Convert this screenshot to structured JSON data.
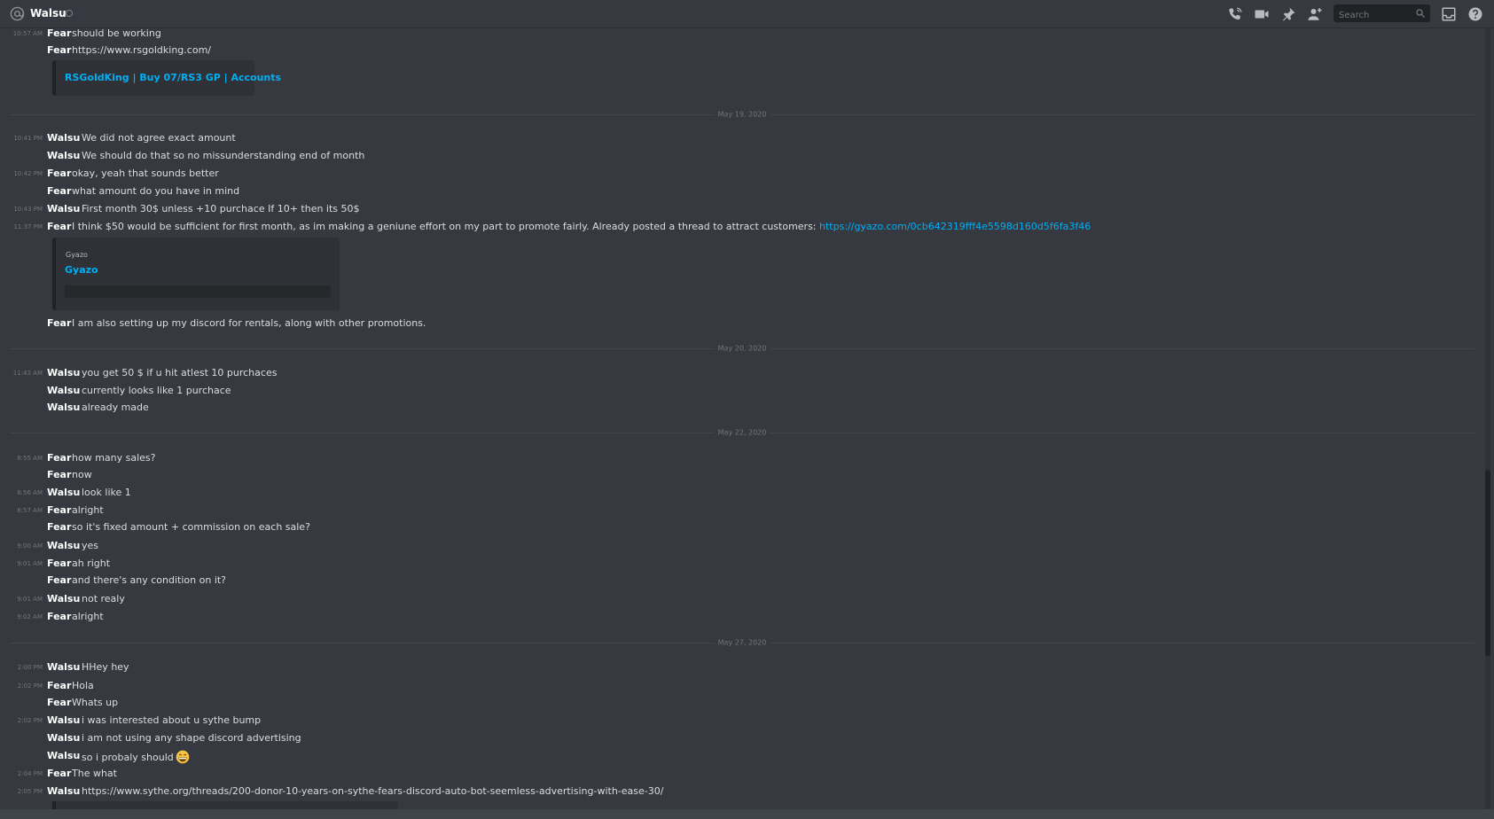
{
  "header": {
    "channel_name": "Walsu",
    "search_placeholder": "Search"
  },
  "messages": [
    {
      "ts": "10:57 AM",
      "author": "Fear",
      "text": "should be working"
    },
    {
      "ts": "",
      "author": "Fear",
      "text": "",
      "link": "https://www.rsgoldking.com/"
    },
    {
      "ts": "10:41 PM",
      "author": "Walsu",
      "text": "We did not agree exact amount"
    },
    {
      "ts": "",
      "author": "Walsu",
      "text": "We should do that so no missunderstanding end of month"
    },
    {
      "ts": "10:42 PM",
      "author": "Fear",
      "text": "okay, yeah that sounds better"
    },
    {
      "ts": "",
      "author": "Fear",
      "text": "what amount do you have in mind"
    },
    {
      "ts": "10:43 PM",
      "author": "Walsu",
      "text": "First month 30$ unless +10 purchace If 10+ then its 50$"
    },
    {
      "ts": "11:37 PM",
      "author": "Fear",
      "text": "I think $50 would be sufficient for first month, as im making a geniune effort on my part to promote fairly. Already posted a thread to attract customers: ",
      "link": "https://gyazo.com/0cb642319fff4e5598d160d5f6fa3f46"
    },
    {
      "ts": "",
      "author": "Fear",
      "text": "I am also setting up my discord for rentals, along with other promotions."
    },
    {
      "ts": "11:43 AM",
      "author": "Walsu",
      "text": "you get 50 $ if u hit atlest 10 purchaces"
    },
    {
      "ts": "",
      "author": "Walsu",
      "text": "currently looks like 1 purchace"
    },
    {
      "ts": "",
      "author": "Walsu",
      "text": "already made"
    },
    {
      "ts": "8:55 AM",
      "author": "Fear",
      "text": "how many sales?"
    },
    {
      "ts": "",
      "author": "Fear",
      "text": "now"
    },
    {
      "ts": "8:56 AM",
      "author": "Walsu",
      "text": "look like 1"
    },
    {
      "ts": "8:57 AM",
      "author": "Fear",
      "text": "alright"
    },
    {
      "ts": "",
      "author": "Fear",
      "text": "so it's fixed amount + commission on each sale?"
    },
    {
      "ts": "9:00 AM",
      "author": "Walsu",
      "text": "yes"
    },
    {
      "ts": "9:01 AM",
      "author": "Fear",
      "text": "ah right"
    },
    {
      "ts": "",
      "author": "Fear",
      "text": "and there's any condition on it?"
    },
    {
      "ts": "9:01 AM",
      "author": "Walsu",
      "text": "not realy"
    },
    {
      "ts": "9:02 AM",
      "author": "Fear",
      "text": "alright"
    },
    {
      "ts": "2:00 PM",
      "author": "Walsu",
      "text": "HHey hey"
    },
    {
      "ts": "2:02 PM",
      "author": "Fear",
      "text": "Hola"
    },
    {
      "ts": "",
      "author": "Fear",
      "text": "Whats up"
    },
    {
      "ts": "2:02 PM",
      "author": "Walsu",
      "text": "i was interested about u sythe bump"
    },
    {
      "ts": "",
      "author": "Walsu",
      "text": "i am not using any shape discord advertising"
    },
    {
      "ts": "",
      "author": "Walsu",
      "text": "so i probaly should",
      "emoji": "grinning-face-emoji"
    },
    {
      "ts": "2:04 PM",
      "author": "Fear",
      "text": "The what"
    },
    {
      "ts": "2:05 PM",
      "author": "Walsu",
      "text": "",
      "link": "https://www.sythe.org/threads/200-donor-10-years-on-sythe-fears-discord-auto-bot-seemless-advertising-with-ease-30/"
    }
  ],
  "dividers": [
    "May 19, 2020",
    "May 20, 2020",
    "May 22, 2020",
    "May 27, 2020"
  ],
  "embeds": {
    "rsgoldking": {
      "title": "RSGoldKing | Buy 07/RS3 GP | Accounts"
    },
    "gyazo": {
      "provider": "Gyazo",
      "title": "Gyazo"
    }
  },
  "colors": {
    "background": "#36393f",
    "link": "#00aff4",
    "embed": "#2f3136"
  }
}
